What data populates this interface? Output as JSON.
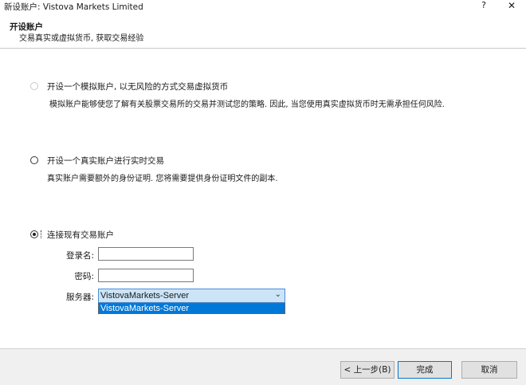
{
  "window": {
    "title": "新设账户: Vistova Markets Limited",
    "help_label": "?",
    "close_label": "✕"
  },
  "header": {
    "title": "开设账户",
    "subtitle": "交易真实或虚拟货币, 获取交易经验"
  },
  "options": [
    {
      "label": "开设一个模拟账户, 以无风险的方式交易虚拟货币",
      "description": "模拟账户能够使您了解有关股票交易所的交易并测试您的策略. 因此, 当您使用真实虚拟货币时无需承担任何风险.",
      "state": "disabled"
    },
    {
      "label": "开设一个真实账户进行实时交易",
      "description": "真实账户需要额外的身份证明. 您将需要提供身份证明文件的副本.",
      "state": "unchecked"
    },
    {
      "label": "连接现有交易账户",
      "description": "",
      "state": "checked"
    }
  ],
  "login_form": {
    "login_label": "登录名:",
    "login_value": "",
    "password_label": "密码:",
    "password_value": "",
    "server_label": "服务器:",
    "server_value": "VistovaMarkets-Server",
    "server_options": [
      "VistovaMarkets-Server"
    ]
  },
  "buttons": {
    "back": "< 上一步(B)",
    "finish": "完成",
    "cancel": "取消"
  },
  "colors": {
    "selection": "#0078d7",
    "combo_highlight": "#cce4f7"
  },
  "icons": {
    "dropdown_arrow": "chevron-down-icon"
  }
}
